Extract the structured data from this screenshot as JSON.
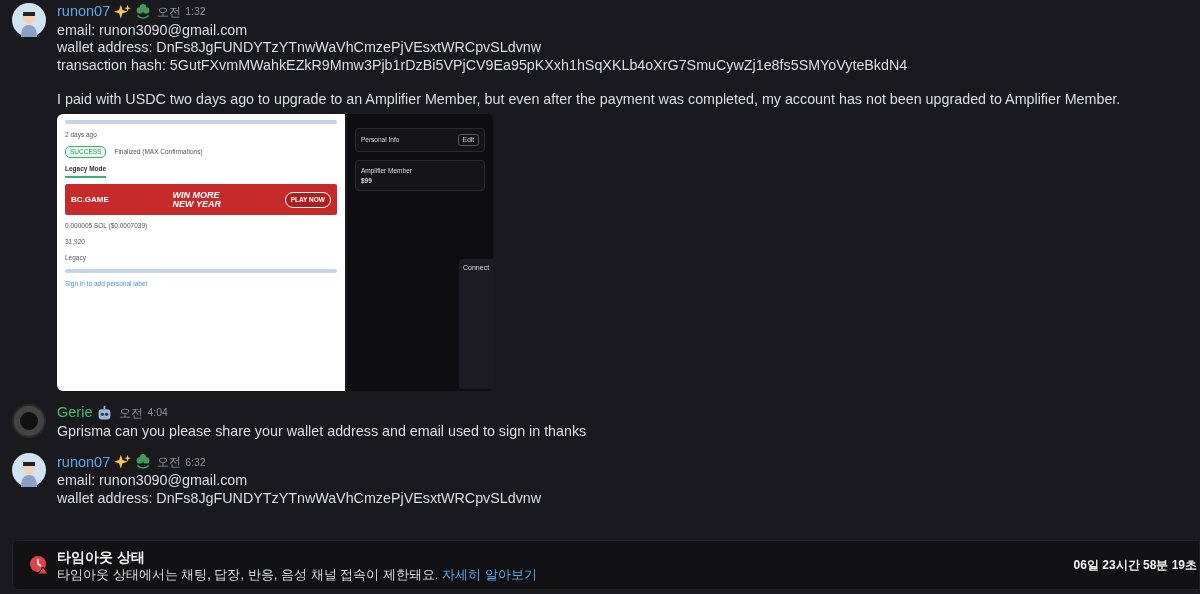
{
  "messages": [
    {
      "kind": "member",
      "author": "runon07",
      "color": "#5aa6e8",
      "meridiem": "오전",
      "time": "1:32",
      "paragraphs": [
        [
          "email: runon3090@gmail.com",
          "wallet address: DnFs8JgFUNDYTzYTnwWaVhCmzePjVEsxtWRCpvSLdvnw",
          "transaction hash: 5GutFXvmMWahkEZkR9Mmw3Pjb1rDzBi5VPjCV9Ea95pKXxh1hSqXKLb4oXrG7SmuCywZj1e8fs5SMYoVyteBkdN4"
        ],
        [
          "I paid with USDC two days ago to upgrade to an Amplifier Member, but even after the payment was completed, my account has not been upgraded to Amplifier Member."
        ]
      ],
      "attachments": [
        {
          "kind": "explorer",
          "age": "2 days ago",
          "status": "SUCCESS",
          "finality": "Finalized (MAX Confirmations)",
          "tab": "Legacy Mode",
          "banner": {
            "brand": "BC.GAME",
            "headline": "WIN MORE",
            "subline": "NEW YEAR",
            "cta": "PLAY NOW"
          },
          "fee": "0.000005 SOL ($0.0007039)",
          "compute": "31,920",
          "version": "Legacy",
          "label_link": "Sign in to add personal label"
        },
        {
          "kind": "profile",
          "section": "Personal Info",
          "edit": "Edit",
          "plan": "Amplifier Member",
          "price": "$99",
          "panel": "Connect"
        }
      ]
    },
    {
      "kind": "staff",
      "author": "Gerie",
      "color": "#3fbf6f",
      "meridiem": "오전",
      "time": "4:04",
      "paragraphs": [
        [
          "Gprisma can you please share your wallet address and email used to sign in thanks"
        ]
      ]
    },
    {
      "kind": "member",
      "author": "runon07",
      "color": "#5aa6e8",
      "meridiem": "오전",
      "time": "6:32",
      "paragraphs": [
        [
          "email: runon3090@gmail.com",
          "wallet address: DnFs8JgFUNDYTzYTnwWaVhCmzePjVEsxtWRCpvSLdvnw"
        ]
      ]
    }
  ],
  "notice": {
    "title": "타임아웃 상태",
    "text": "타임아웃 상태에서는 채팅, 답장, 반응, 음성 채널 접속이 제한돼요.",
    "link": "자세히 알아보기",
    "timer": "06일 23시간 58분 19초"
  }
}
